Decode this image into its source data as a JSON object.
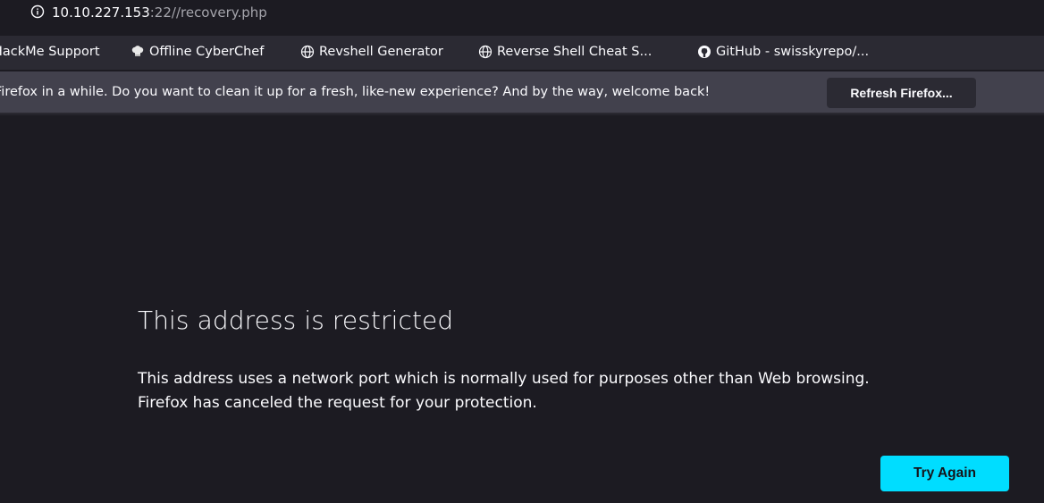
{
  "url": {
    "host": "10.10.227.153",
    "rest": ":22//recovery.php"
  },
  "bookmarks": [
    {
      "label": "HackMe Support",
      "icon": "none"
    },
    {
      "label": "Offline CyberChef",
      "icon": "chef-hat-icon"
    },
    {
      "label": "Revshell Generator",
      "icon": "globe-icon"
    },
    {
      "label": "Reverse Shell Cheat S...",
      "icon": "globe-icon"
    },
    {
      "label": "GitHub - swisskyrepo/...",
      "icon": "github-icon"
    }
  ],
  "notification": {
    "text": "Firefox in a while. Do you want to clean it up for a fresh, like-new experience? And by the way, welcome back!",
    "button_label": "Refresh Firefox..."
  },
  "error": {
    "title": "This address is restricted",
    "line1": "This address uses a network port which is normally used for purposes other than Web browsing.",
    "line2": "Firefox has canceled the request for your protection.",
    "button_label": "Try Again"
  },
  "colors": {
    "page_bg": "#1c1b22",
    "accent": "#00ddff",
    "notification_bg": "#42414d",
    "toolbar_bg": "#2b2a33"
  }
}
